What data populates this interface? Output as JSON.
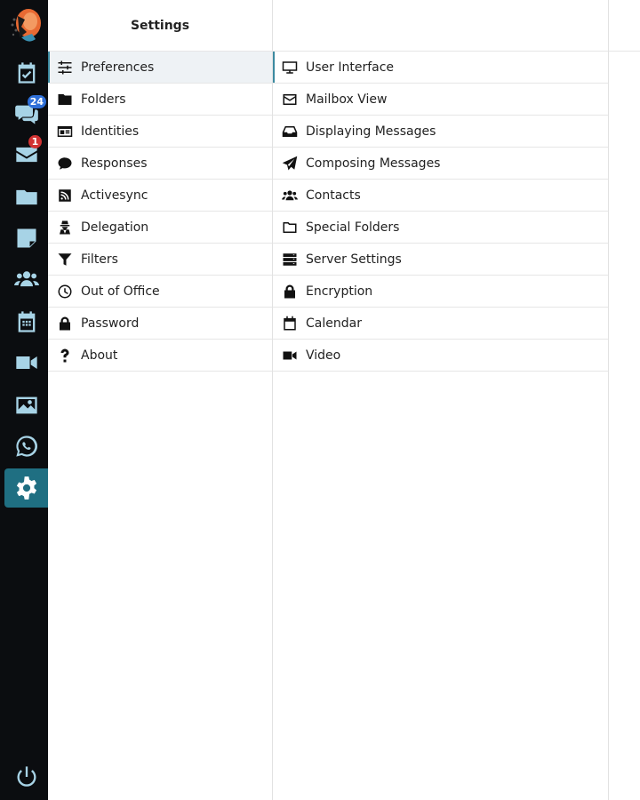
{
  "settings_title": "Settings",
  "rail": {
    "badges": {
      "chat": "24",
      "mail": "1"
    },
    "items": [
      "tasks",
      "chat",
      "mail",
      "files",
      "notes",
      "contacts",
      "calendar",
      "video",
      "gallery",
      "whatsapp",
      "settings",
      "logout"
    ]
  },
  "sections": [
    {
      "label": "Preferences",
      "icon": "sliders-icon"
    },
    {
      "label": "Folders",
      "icon": "folder-icon"
    },
    {
      "label": "Identities",
      "icon": "id-card-icon"
    },
    {
      "label": "Responses",
      "icon": "comment-icon"
    },
    {
      "label": "Activesync",
      "icon": "rss-icon"
    },
    {
      "label": "Delegation",
      "icon": "user-secret-icon"
    },
    {
      "label": "Filters",
      "icon": "filter-icon"
    },
    {
      "label": "Out of Office",
      "icon": "clock-icon"
    },
    {
      "label": "Password",
      "icon": "lock-icon"
    },
    {
      "label": "About",
      "icon": "question-icon"
    }
  ],
  "preferences": [
    {
      "label": "User Interface",
      "icon": "desktop-icon"
    },
    {
      "label": "Mailbox View",
      "icon": "envelope-icon"
    },
    {
      "label": "Displaying Messages",
      "icon": "inbox-icon"
    },
    {
      "label": "Composing Messages",
      "icon": "paper-plane-icon"
    },
    {
      "label": "Contacts",
      "icon": "users-icon"
    },
    {
      "label": "Special Folders",
      "icon": "folder-open-icon"
    },
    {
      "label": "Server Settings",
      "icon": "server-icon"
    },
    {
      "label": "Encryption",
      "icon": "lock-icon"
    },
    {
      "label": "Calendar",
      "icon": "calendar-icon"
    },
    {
      "label": "Video",
      "icon": "video-icon"
    }
  ],
  "colors": {
    "rail_bg": "#0b0d10",
    "rail_icon": "#a7d3e6",
    "accent": "#1f6f82"
  }
}
